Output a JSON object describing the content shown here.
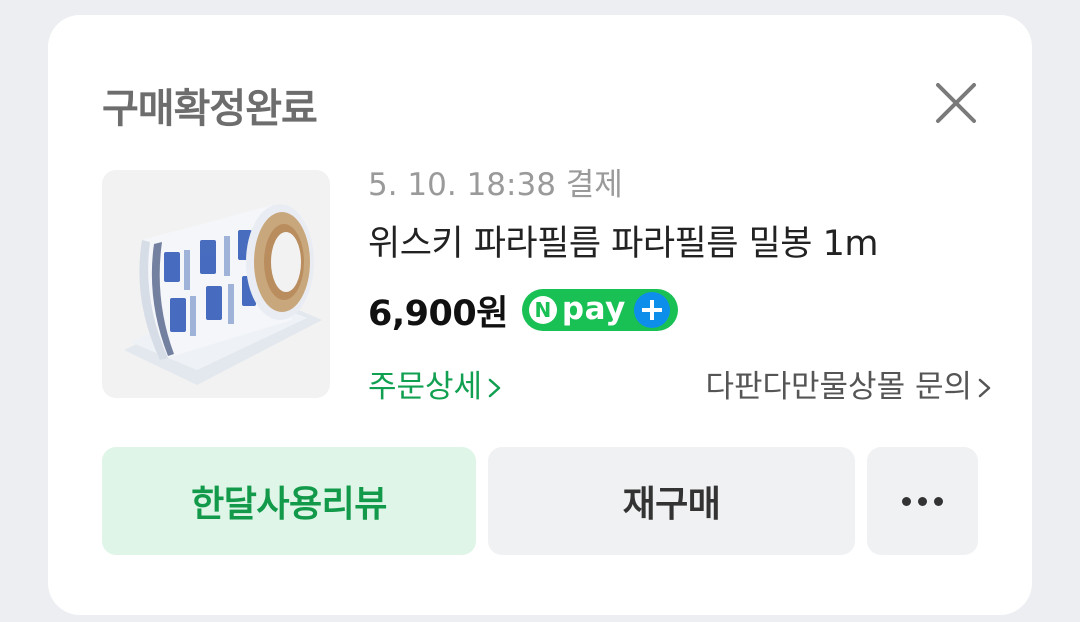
{
  "card": {
    "title": "구매확정완료",
    "close_icon": "close-icon"
  },
  "order": {
    "date": "5. 10. 18:38 결제",
    "product_name": "위스키 파라필름 파라필름 밀봉 1m",
    "price": "6,900원",
    "pay_badge": {
      "n": "N",
      "label": "pay",
      "plus_icon": "plus-icon",
      "color": "#19c155",
      "plus_color": "#0d8eea"
    },
    "thumbnail_icon": "parafilm-roll-image",
    "detail_link": "주문상세",
    "inquiry_link": "다판다만물상몰 문의",
    "chevron_icon": "chevron-right-icon"
  },
  "actions": {
    "review_label": "한달사용리뷰",
    "rebuy_label": "재구매",
    "more_icon": "more-dots-icon"
  },
  "colors": {
    "accent_green": "#11a051",
    "review_bg": "#dff5e8"
  }
}
